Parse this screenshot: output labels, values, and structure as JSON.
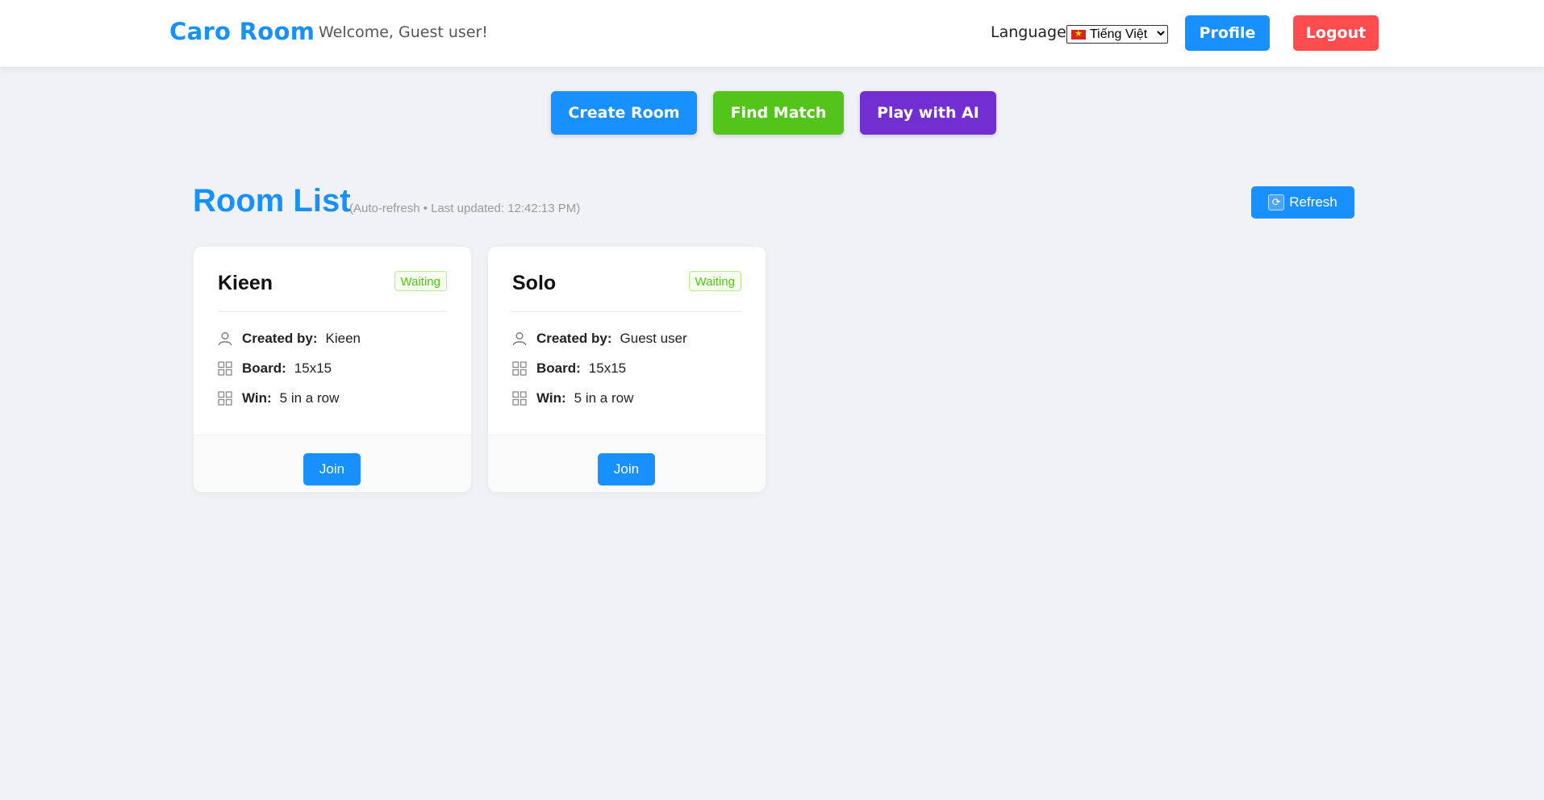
{
  "header": {
    "logo": "Caro Room",
    "welcome": "Welcome, Guest user!",
    "language_label": "Language:",
    "language_value": "Tiếng Việt",
    "language_flag": "vietnam-flag-icon",
    "profile_label": "Profile",
    "logout_label": "Logout"
  },
  "actions": {
    "create_room": "Create Room",
    "find_match": "Find Match",
    "play_ai": "Play with AI"
  },
  "room_list": {
    "title": "Room List",
    "subtitle": "(Auto-refresh • Last updated: 12:42:13 PM)",
    "refresh_label": "Refresh",
    "created_by_label": "Created by:",
    "board_label": "Board:",
    "win_label": "Win:",
    "join_label": "Join",
    "rooms": [
      {
        "name": "Kieen",
        "status": "Waiting",
        "created_by": "Kieen",
        "board": "15x15",
        "win": "5 in a row"
      },
      {
        "name": "Solo",
        "status": "Waiting",
        "created_by": "Guest user",
        "board": "15x15",
        "win": "5 in a row"
      }
    ]
  },
  "colors": {
    "primary": "#1890ff",
    "success": "#52c41a",
    "purple": "#722ed1",
    "danger": "#ff4d4f",
    "background": "#f0f2f5"
  }
}
